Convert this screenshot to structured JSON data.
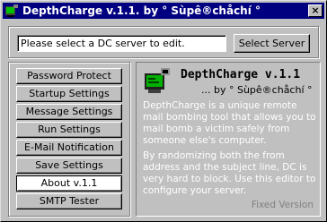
{
  "window": {
    "title": "DepthCharge v.1.1. by ° Sùpê®chåchí °",
    "close_label": "×"
  },
  "server": {
    "input_value": "Please select a DC server to edit.",
    "select_button": "Select Server"
  },
  "nav": {
    "items": [
      {
        "label": "Password Protect"
      },
      {
        "label": "Startup Settings"
      },
      {
        "label": "Message Settings"
      },
      {
        "label": "Run Settings"
      },
      {
        "label": "E-Mail Notification"
      },
      {
        "label": "Save Settings"
      },
      {
        "label": "About v.1.1",
        "active": true
      },
      {
        "label": "SMTP Tester"
      }
    ]
  },
  "about": {
    "heading": "DepthCharge v.1.1",
    "byline": "... by ° Sùpê®chåchí °",
    "description": "DepthCharge is a unique remote mail bombing tool that allows you to mail bomb a victim safely from someone else's computer.",
    "description2": "By randomizing both the from address and the subject line, DC is very hard to block. Use this editor to configure your server.",
    "footer": "Fixed Version"
  },
  "colors": {
    "titlebar": "#000080",
    "face": "#c0c0c0",
    "desc_text": "#ffffff",
    "footer_text": "#808080"
  }
}
